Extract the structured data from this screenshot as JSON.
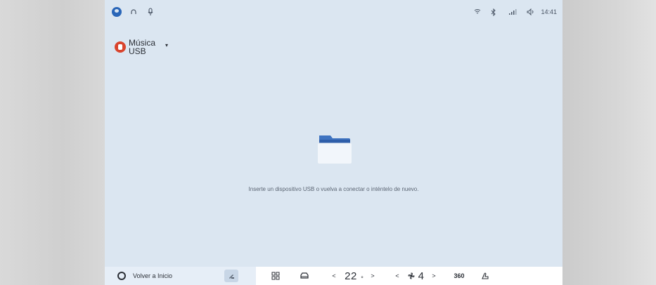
{
  "status_bar": {
    "icons": [
      "user-icon",
      "headphones-icon",
      "mic-icon",
      "wifi-icon",
      "bluetooth-icon",
      "signal-icon",
      "volume-icon"
    ],
    "time": "14:41"
  },
  "source": {
    "title_line1": "Música",
    "title_line2": "USB",
    "icon": "usb-music-icon"
  },
  "empty_state": {
    "message": "Inserte un dispositivo USB o vuelva a conectar o inténtelo de nuevo."
  },
  "bottom_bar": {
    "home_label": "Volver a Inicio",
    "temperature": "22",
    "temperature_unit": "°",
    "fan_level": "4",
    "view_360": "360",
    "prev_temp": "<",
    "next_temp": ">",
    "prev_fan": "<",
    "next_fan": ">"
  },
  "colors": {
    "screen_bg": "#dbe6f1",
    "accent_blue": "#2a66b8",
    "folder_blue": "#3f74c1",
    "source_icon_red": "#d9442d"
  }
}
